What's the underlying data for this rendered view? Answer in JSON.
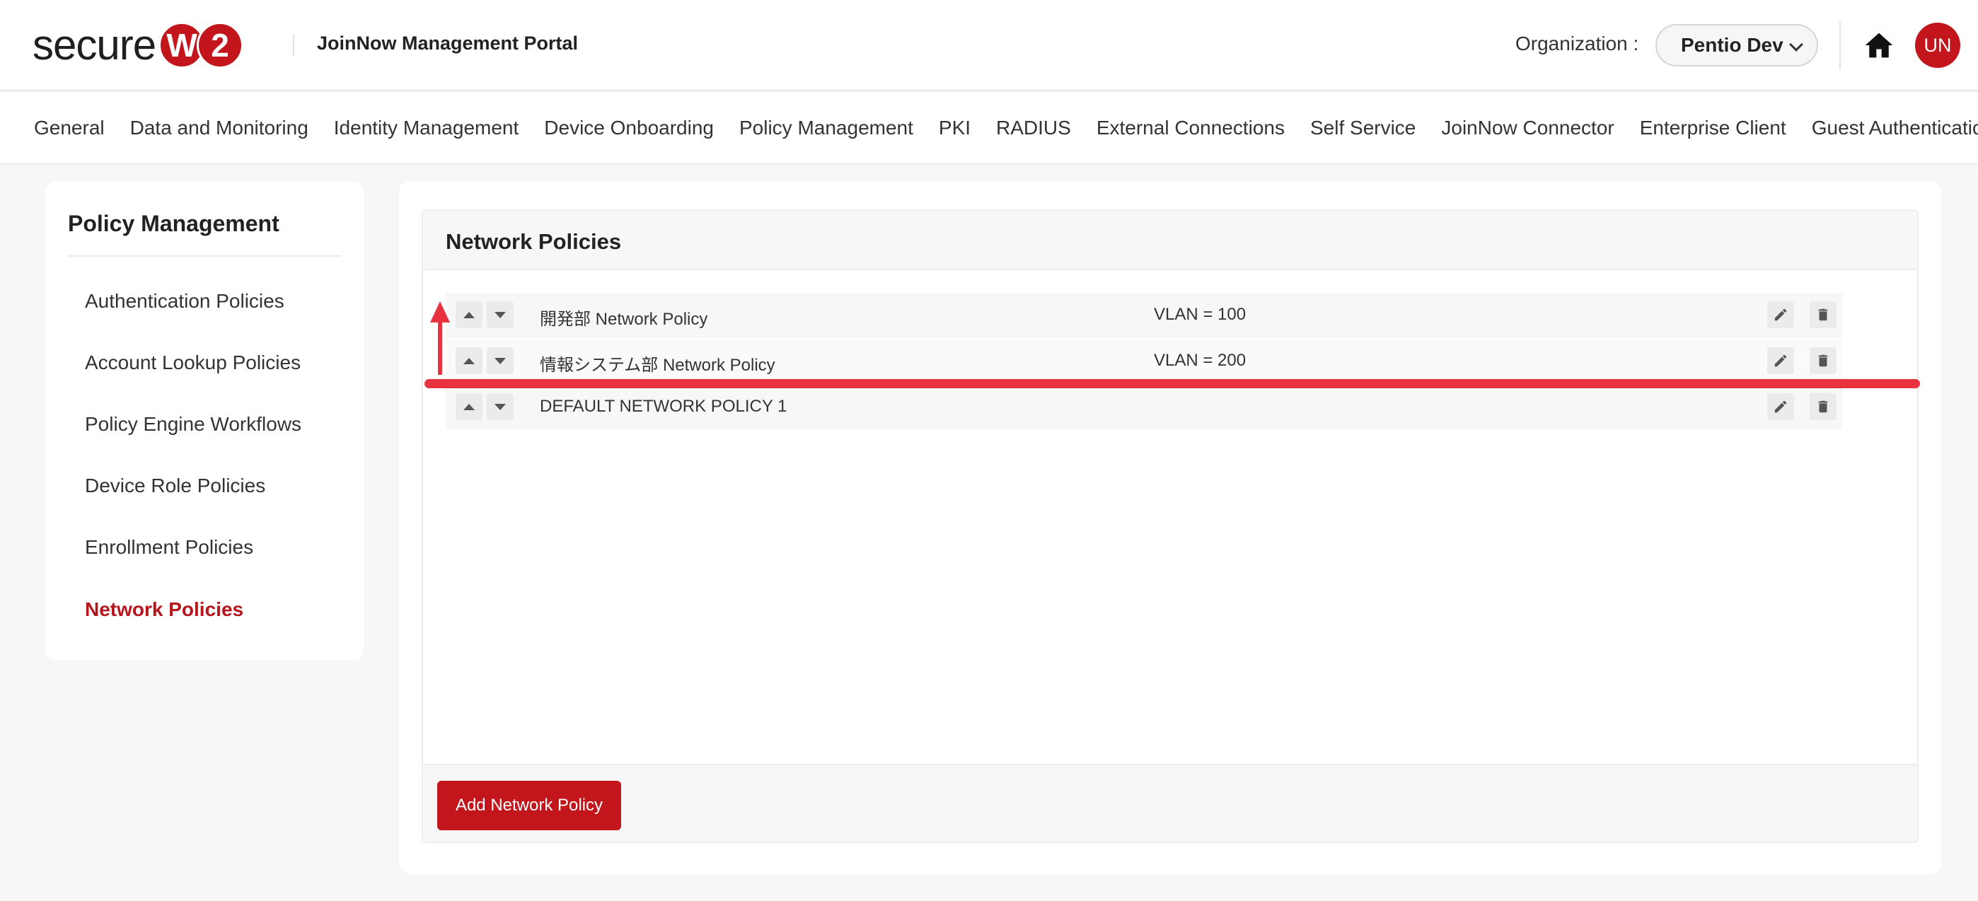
{
  "header": {
    "logo_word": "secure",
    "logo_badge_a": "W",
    "logo_badge_b": "2",
    "portal_title": "JoinNow Management Portal",
    "org_label": "Organization :",
    "org_value": "Pentio Dev",
    "avatar_initials": "UN"
  },
  "nav": {
    "items": [
      "General",
      "Data and Monitoring",
      "Identity Management",
      "Device Onboarding",
      "Policy Management",
      "PKI",
      "RADIUS",
      "External Connections",
      "Self Service",
      "JoinNow Connector",
      "Enterprise Client",
      "Guest Authentication"
    ]
  },
  "sidebar": {
    "title": "Policy Management",
    "items": [
      "Authentication Policies",
      "Account Lookup Policies",
      "Policy Engine Workflows",
      "Device Role Policies",
      "Enrollment Policies",
      "Network Policies"
    ],
    "active_index": 5
  },
  "panel": {
    "title": "Network Policies",
    "rows": [
      {
        "name": "開発部 Network Policy",
        "vlan": "VLAN = 100"
      },
      {
        "name": "情報システム部 Network Policy",
        "vlan": "VLAN = 200"
      },
      {
        "name": "DEFAULT NETWORK POLICY 1",
        "vlan": ""
      }
    ],
    "add_button": "Add Network Policy"
  },
  "colors": {
    "brand": "#c3161c",
    "annotation": "#e8323f"
  }
}
